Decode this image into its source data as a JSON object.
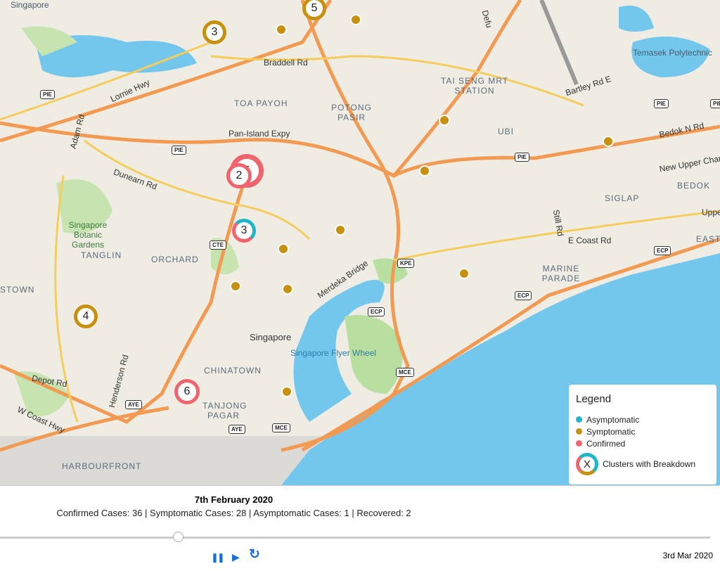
{
  "map": {
    "area_labels": [
      "TOA PAYOH",
      "POTONG PASIR",
      "TAI SENG MRT STATION",
      "UBI",
      "BEDOK",
      "SIGLAP",
      "MARINE PARADE",
      "EAST",
      "TANGLIN",
      "ORCHARD",
      "STOWN",
      "CHINATOWN",
      "TANJONG PAGAR",
      "HARBOURFRONT"
    ],
    "road_labels": [
      "Braddell Rd",
      "Lornie Hwy",
      "Adam Rd",
      "Pan-Island Expy",
      "Dunearn Rd",
      "Bartley Rd E",
      "Bedok N Rd",
      "New Upper Chang",
      "Upper",
      "E Coast Rd",
      "Still Rd",
      "Merdeka Bridge",
      "Henderson Rd",
      "Depot Rd",
      "W Coast Hwy",
      "Defu"
    ],
    "shields": [
      "PIE",
      "PIE",
      "PIE",
      "PIE",
      "PIE",
      "CTE",
      "KPE",
      "ECP",
      "ECP",
      "ECP",
      "MCE",
      "AYE",
      "AYE",
      "MCE"
    ],
    "place_labels": [
      "Singapore Botanic Gardens",
      "Singapore",
      "Singapore Flyer Wheel",
      "Temasek Polytechnic",
      "Singapore"
    ],
    "clusters": [
      {
        "count": "5",
        "type": "symptomatic"
      },
      {
        "count": "3",
        "type": "symptomatic"
      },
      {
        "count": "5",
        "type": "confirmed"
      },
      {
        "count": "2",
        "type": "confirmed"
      },
      {
        "count": "3",
        "type": "breakdown"
      },
      {
        "count": "4",
        "type": "symptomatic"
      },
      {
        "count": "6",
        "type": "confirmed"
      }
    ]
  },
  "legend": {
    "title": "Legend",
    "items": [
      {
        "label": "Asymptomatic",
        "color": "#1fb5c9"
      },
      {
        "label": "Symptomatic",
        "color": "#c8900f"
      },
      {
        "label": "Confirmed",
        "color": "#f0646e"
      }
    ],
    "cluster_symbol": "X",
    "cluster_label": "Clusters with Breakdown"
  },
  "timeline": {
    "current_date": "7th February 2020",
    "stats": "Confirmed Cases: 36 | Symptomatic Cases: 28 | Asymptomatic Cases: 1 | Recovered: 2",
    "end_date": "3rd Mar 2020",
    "progress_percent": 25,
    "pause_icon": "❚❚",
    "play_icon": "▶",
    "replay_icon": "↻"
  }
}
